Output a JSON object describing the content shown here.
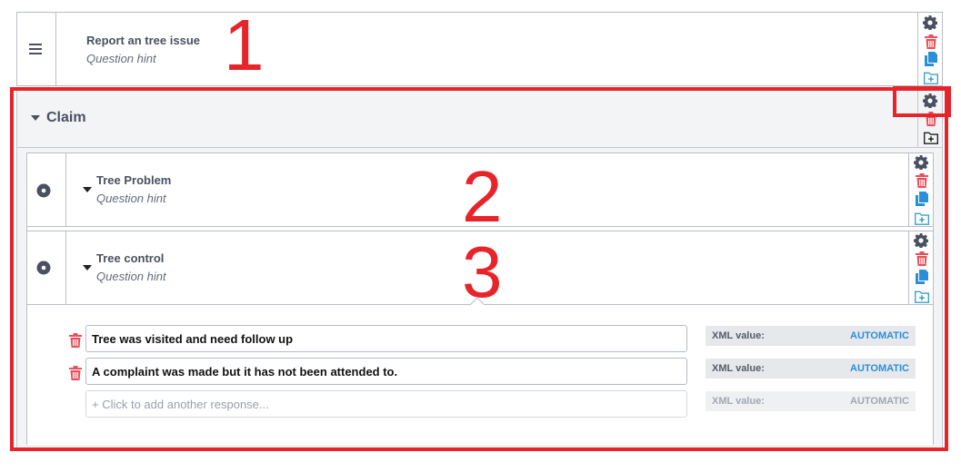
{
  "question1": {
    "title": "Report an tree issue",
    "hint": "Question hint"
  },
  "group": {
    "title": "Claim"
  },
  "question2": {
    "title": "Tree Problem",
    "hint": "Question hint"
  },
  "question3": {
    "title": "Tree control",
    "hint": "Question hint",
    "responses": [
      {
        "text": "Tree was visited and need follow up",
        "xml_label": "XML value:",
        "xml_value": "AUTOMATIC"
      },
      {
        "text": "A complaint was made but it has not been attended to.",
        "xml_label": "XML value:",
        "xml_value": "AUTOMATIC"
      }
    ],
    "add_response": {
      "placeholder": "+ Click to add another response...",
      "xml_label": "XML value:",
      "xml_value": "AUTOMATIC"
    }
  },
  "annotations": {
    "n1": "1",
    "n2": "2",
    "n3": "3"
  },
  "colors": {
    "gear": "#4a5060",
    "trash": "#e8505b",
    "copy": "#2a8fd8",
    "folder": "#3aa0c8",
    "annotation": "#e8242b"
  },
  "icons": [
    "hamburger-icon",
    "gear-icon",
    "trash-icon",
    "copy-icon",
    "folder-add-icon",
    "caret-down-icon",
    "radio-icon"
  ]
}
